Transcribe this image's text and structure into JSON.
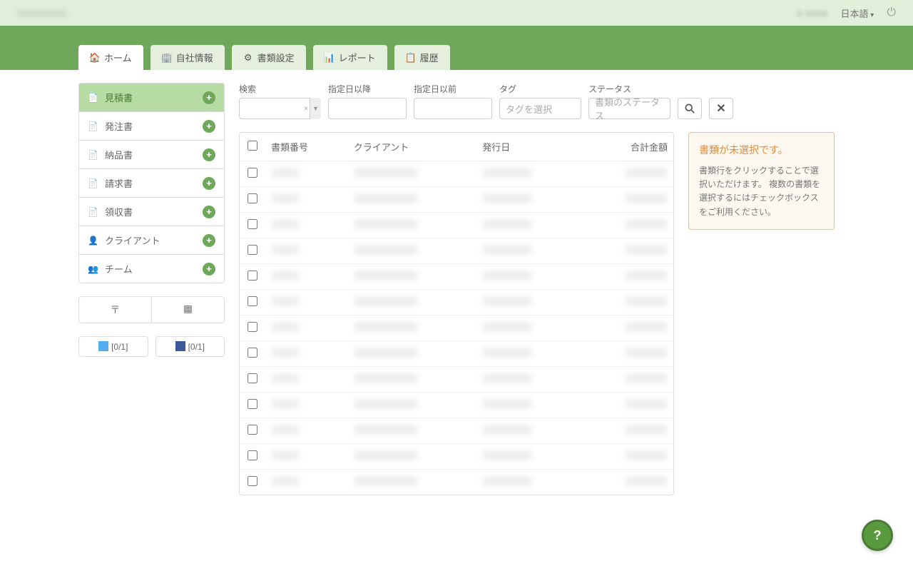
{
  "topbar": {
    "brand": "■■■■■■■■",
    "user": "■ ■■■■",
    "lang": "日本語"
  },
  "tabs": [
    {
      "label": "ホーム",
      "icon": "home"
    },
    {
      "label": "自社情報",
      "icon": "building"
    },
    {
      "label": "書類設定",
      "icon": "gear"
    },
    {
      "label": "レポート",
      "icon": "chart"
    },
    {
      "label": "履歴",
      "icon": "history"
    }
  ],
  "sidebar": {
    "items": [
      {
        "label": "見積書",
        "icon": "doc",
        "active": true
      },
      {
        "label": "発注書",
        "icon": "doc"
      },
      {
        "label": "納品書",
        "icon": "doc"
      },
      {
        "label": "請求書",
        "icon": "doc"
      },
      {
        "label": "領収書",
        "icon": "doc"
      },
      {
        "label": "クライアント",
        "icon": "person"
      },
      {
        "label": "チーム",
        "icon": "team"
      }
    ],
    "social": [
      {
        "label": "[0/1]",
        "net": "tw"
      },
      {
        "label": "[0/1]",
        "net": "fb"
      }
    ]
  },
  "filters": {
    "search_label": "検索",
    "date_from_label": "指定日以降",
    "date_to_label": "指定日以前",
    "tag_label": "タグ",
    "tag_placeholder": "タグを選択",
    "status_label": "ステータス",
    "status_placeholder": "書類のステータス"
  },
  "table": {
    "headers": {
      "doc_no": "書類番号",
      "client": "クライアント",
      "issue_date": "発行日",
      "total": "合計金額"
    },
    "row_count": 13
  },
  "info": {
    "title": "書類が未選択です。",
    "body": "書類行をクリックすることで選択いただけます。\n複数の書類を選択するにはチェックボックスをご利用ください。"
  },
  "fab": "?"
}
